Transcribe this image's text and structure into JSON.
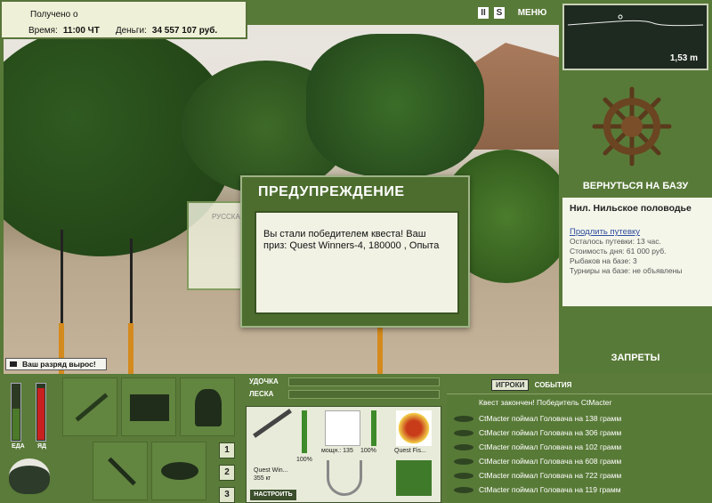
{
  "status": {
    "received_label": "Получено о",
    "time_label": "Время:",
    "time_value": "11:00 ЧТ",
    "money_label": "Деньги:",
    "money_value": "34 557 107 руб."
  },
  "top_menu": {
    "pause_icon": "pause-icon",
    "sound_label": "S",
    "menu_label": "МЕНЮ"
  },
  "depth": {
    "value": "1,53 m"
  },
  "right_panel": {
    "return_label": "ВЕРНУТЬСЯ НА БАЗУ",
    "location_title": "Нил. Нильское половодье",
    "extend_link": "Продлить путевку",
    "left_label": "Осталось путевки: 13 час.",
    "day_cost": "Стоимость дня: 61 000 руб.",
    "fishers": "Рыбаков на базе: 3",
    "tournaments": "Турниры на базе: не объявлены",
    "bans_label": "ЗАПРЕТЫ"
  },
  "dialog": {
    "title": "ПРЕДУПРЕЖДЕНИЕ",
    "message": "Вы стали победителем квеста! Ваш приз: Quest Winners-4, 180000 , Опыта",
    "behind_label": "РУССКАЯ"
  },
  "rank_notice": "Ваш разряд вырос!",
  "meters": {
    "food_label": "ЕДА",
    "poison_label": "ЯД",
    "food_level": 0.55,
    "poison_level": 0.9
  },
  "slots": {
    "rod_icon": "rod-icon",
    "tackle_box_icon": "tackle-box-icon",
    "fisherman_icon": "fisherman-icon",
    "cutlery_icon": "cutlery-icon",
    "fish_icon": "fish-icon",
    "pot_icon": "pot-icon",
    "page_buttons": [
      "1",
      "2",
      "3"
    ]
  },
  "tackle": {
    "rod_label": "УДОЧКА",
    "line_label": "ЛЕСКА",
    "rod_name": "Quest Win...",
    "rod_weight": "355 кг",
    "rod_percent": "100%",
    "reel_power": "мощн.: 135",
    "reel_percent": "100%",
    "line_name": "Quest Fis...",
    "setup_button": "НАСТРОИТЬ"
  },
  "events": {
    "tab_players": "ИГРОКИ",
    "tab_events": "СОБЫТИЯ",
    "items": [
      "Квест закончен! Победитель CtMacter",
      "CtMacter поймал Головача на 138 грамм",
      "CtMacter поймал Головача на 306 грамм",
      "CtMacter поймал Головача на 102 грамм",
      "CtMacter поймал Головача на 608 грамм",
      "CtMacter поймал Головача на 722 грамм",
      "CtMacter поймал Головача на 119 грамм"
    ]
  }
}
